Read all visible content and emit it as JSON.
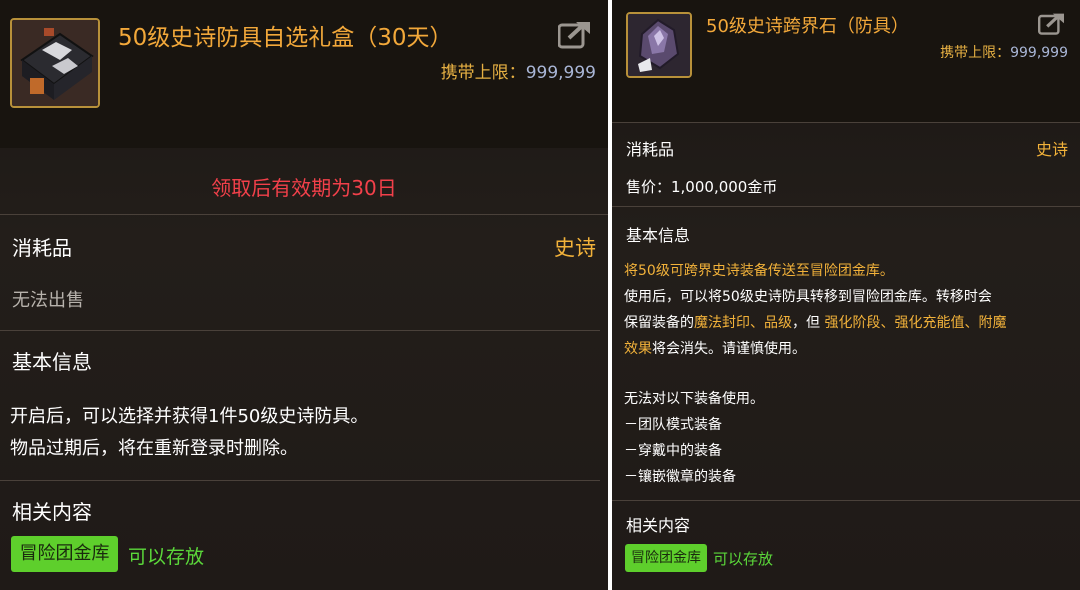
{
  "left": {
    "icon": "gift-box-icon",
    "title": "50级史诗防具自选礼盒（30天）",
    "carry_label": "携带上限：",
    "carry_value": "999,999",
    "expiry_notice": "领取后有效期为30日",
    "category": "消耗品",
    "rarity": "史诗",
    "sell_status": "无法出售",
    "basic_info_label": "基本信息",
    "description": [
      "开启后，可以选择并获得1件50级史诗防具。",
      "物品过期后，将在重新登录时删除。"
    ],
    "related_label": "相关内容",
    "storage_badge": "冒险团金库",
    "storage_status": "可以存放"
  },
  "right": {
    "icon": "crystal-stone-icon",
    "title": "50级史诗跨界石（防具）",
    "carry_label": "携带上限：",
    "carry_value": "999,999",
    "category": "消耗品",
    "rarity": "史诗",
    "price": "售价：1,000,000金币",
    "basic_info_label": "基本信息",
    "desc_line1": "将50级可跨界史诗装备传送至冒险团金库。",
    "desc_line2": "使用后，可以将50级史诗防具转移到冒险团金库。转移时会",
    "desc_line3_a": "保留装备的",
    "desc_line3_b": "魔法封印、品级",
    "desc_line3_c": "，但 ",
    "desc_line3_d": "强化阶段、强化充能值、附魔",
    "desc_line4_a": "效果",
    "desc_line4_b": "将会消失。请谨慎使用。",
    "restriction_title": "无法对以下装备使用。",
    "restrictions": [
      "－团队模式装备",
      "－穿戴中的装备",
      "－镶嵌徽章的装备"
    ],
    "related_label": "相关内容",
    "storage_badge": "冒险团金库",
    "storage_status": "可以存放"
  }
}
